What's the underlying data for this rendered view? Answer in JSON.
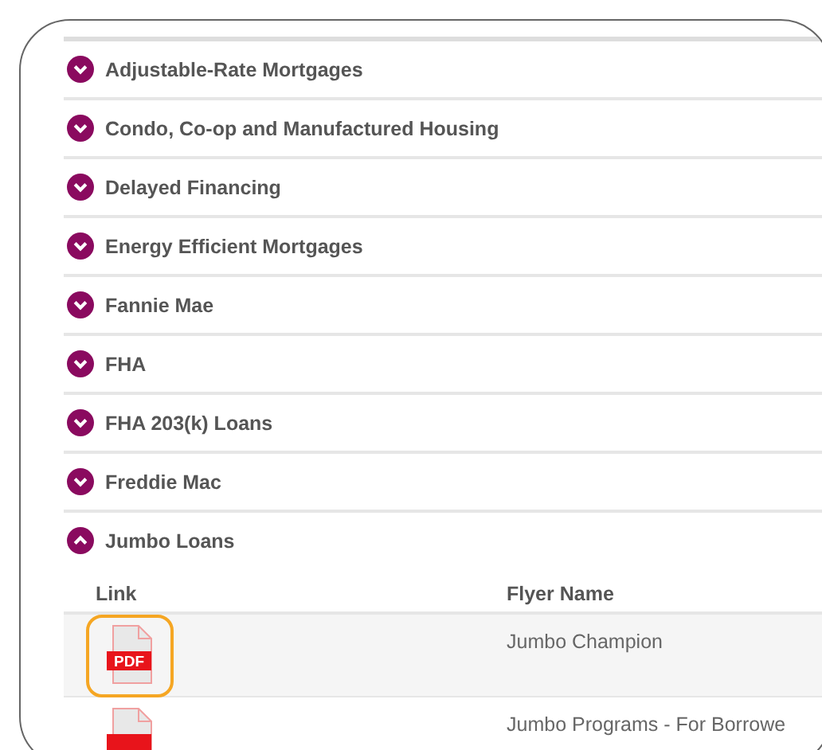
{
  "sections": [
    {
      "title": "Adjustable-Rate Mortgages",
      "expanded": false
    },
    {
      "title": "Condo, Co-op and Manufactured Housing",
      "expanded": false
    },
    {
      "title": "Delayed Financing",
      "expanded": false
    },
    {
      "title": "Energy Efficient Mortgages",
      "expanded": false
    },
    {
      "title": "Fannie Mae",
      "expanded": false
    },
    {
      "title": "FHA",
      "expanded": false
    },
    {
      "title": "FHA 203(k) Loans",
      "expanded": false
    },
    {
      "title": "Freddie Mac",
      "expanded": false
    },
    {
      "title": "Jumbo Loans",
      "expanded": true,
      "table": {
        "columns": [
          "Link",
          "Flyer Name"
        ],
        "rows": [
          {
            "file_label": "PDF",
            "focused": true,
            "flyer_name": "Jumbo Champion"
          },
          {
            "focused": false,
            "flyer_name": "Jumbo Programs - For Borrowe"
          }
        ]
      }
    }
  ]
}
